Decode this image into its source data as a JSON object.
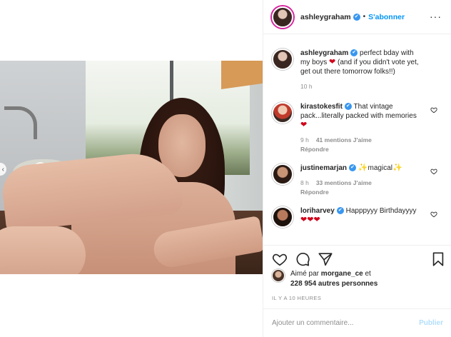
{
  "header": {
    "username": "ashleygraham",
    "separator": "•",
    "follow_label": "S'abonner",
    "more_label": "···"
  },
  "caption": {
    "username": "ashleygraham",
    "text": "perfect bday with my boys",
    "text2": "(and if you didn't vote yet, get out there tomorrow folks!!)",
    "time": "10 h"
  },
  "comments": [
    {
      "username": "kirastokesfit",
      "text": "That vintage pack...literally packed with memories",
      "time": "9 h",
      "likes": "41 mentions J'aime",
      "reply": "Répondre"
    },
    {
      "username": "justinemarjan",
      "text": "magical",
      "time": "8 h",
      "likes": "33 mentions J'aime",
      "reply": "Répondre"
    },
    {
      "username": "loriharvey",
      "text": "Happpyyy Birthdayyyy"
    }
  ],
  "likes": {
    "prefix": "Aimé par",
    "user": "morgane_ce",
    "and": "et",
    "count": "228 954 autres personnes"
  },
  "timestamp": "IL Y A 10 HEURES",
  "compose": {
    "placeholder": "Ajouter un commentaire...",
    "publish_label": "Publier"
  },
  "icons": {
    "verified": "✔",
    "heart_emoji": "❤",
    "bee_emoji": "✨"
  },
  "colors": {
    "accent": "#0095f6",
    "verified": "#3897f0",
    "muted": "#8e8e8e",
    "heart": "#d0021b"
  }
}
